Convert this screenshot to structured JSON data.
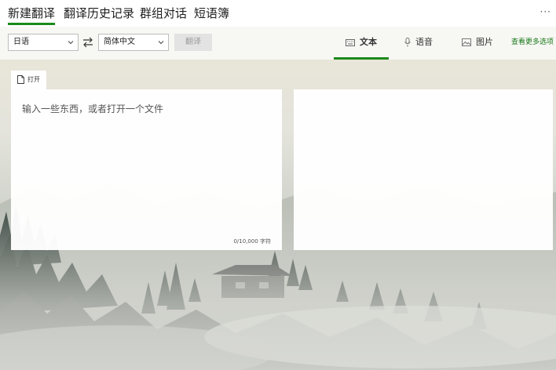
{
  "nav": {
    "tabs": [
      {
        "label": "新建翻译",
        "active": true
      },
      {
        "label": "翻译历史记录",
        "active": false
      },
      {
        "label": "群组对话",
        "active": false
      },
      {
        "label": "短语簿",
        "active": false
      }
    ],
    "more": "···"
  },
  "toolbar": {
    "source_language": "日语",
    "target_language": "简体中文",
    "translate_label": "翻译",
    "modes": [
      {
        "label": "文本",
        "icon": "keyboard-icon",
        "active": true
      },
      {
        "label": "语音",
        "icon": "microphone-icon",
        "active": false
      },
      {
        "label": "图片",
        "icon": "image-icon",
        "active": false
      }
    ],
    "more_options": "查看更多选项"
  },
  "source_panel": {
    "open_label": "打开",
    "placeholder": "输入一些东西，或者打开一个文件",
    "char_count": "0/10,000 字符"
  },
  "colors": {
    "accent": "#1a8a1a",
    "panel": "#ffffff"
  }
}
